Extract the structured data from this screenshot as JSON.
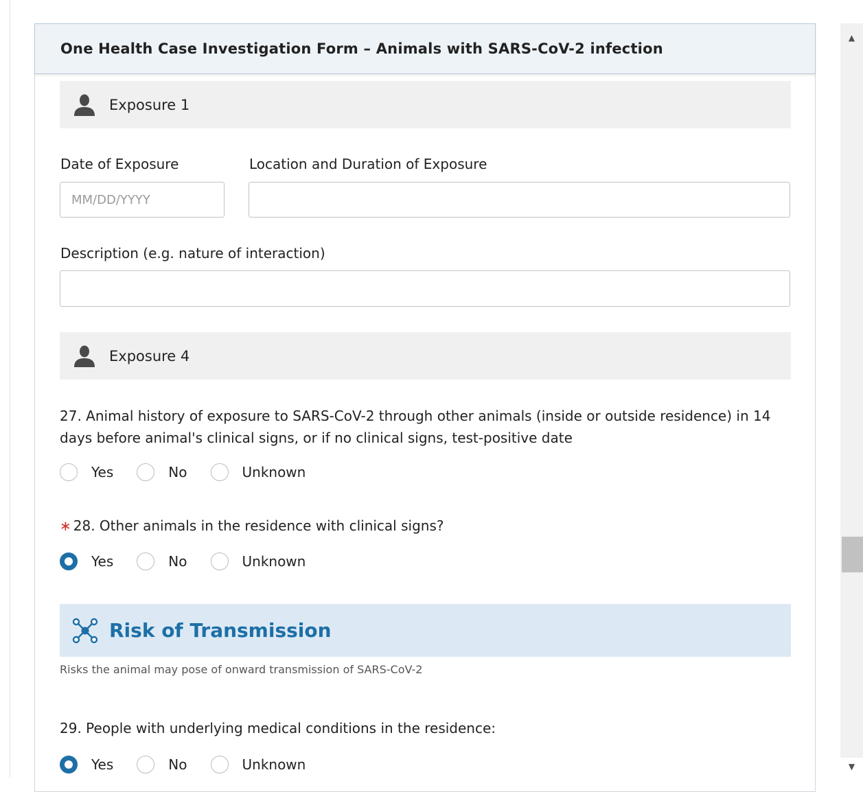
{
  "form": {
    "title": "One Health Case Investigation Form – Animals with SARS-CoV-2 infection"
  },
  "exposure1": {
    "label": "Exposure 1",
    "date_label": "Date of Exposure",
    "date_placeholder": "MM/DD/YYYY",
    "date_value": "",
    "location_label": "Location and Duration of Exposure",
    "location_value": "",
    "description_label": "Description (e.g. nature of interaction)",
    "description_value": ""
  },
  "exposure4": {
    "label": "Exposure 4"
  },
  "q27": {
    "text": "27. Animal history of exposure to SARS-CoV-2 through other animals (inside or outside residence) in 14 days before animal's clinical signs, or if no clinical signs, test-positive date",
    "options": [
      "Yes",
      "No",
      "Unknown"
    ],
    "selected": ""
  },
  "q28": {
    "required_mark": "∗",
    "text": "28. Other animals in the residence with clinical signs?",
    "options": [
      "Yes",
      "No",
      "Unknown"
    ],
    "selected": "Yes"
  },
  "risk": {
    "title": "Risk of Transmission",
    "description": "Risks the animal may pose of onward transmission of SARS-CoV-2"
  },
  "q29": {
    "text": "29. People with underlying medical conditions in the residence:",
    "options": [
      "Yes",
      "No",
      "Unknown"
    ],
    "selected": "Yes"
  },
  "icons": {
    "section": "person-icon",
    "risk": "network-icon",
    "scroll_up": "scroll-up-arrow-icon",
    "scroll_down": "scroll-down-arrow-icon"
  },
  "colors": {
    "accent": "#1d6fa6",
    "required": "#d0342c",
    "risk_bg": "#dce9f5",
    "section_bg": "#f0f0f0",
    "header_bg": "#eef3f7"
  }
}
